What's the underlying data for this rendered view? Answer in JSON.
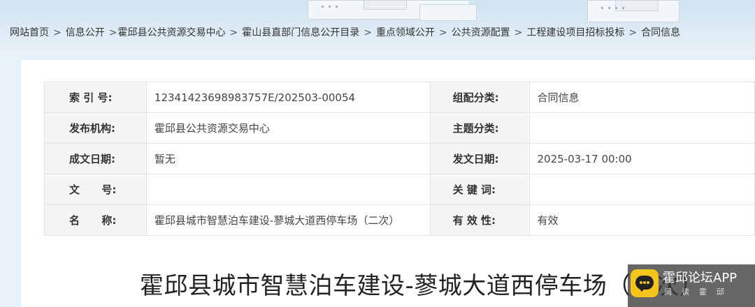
{
  "breadcrumb": [
    "网站首页",
    "信息公开",
    "霍邱县公共资源交易中心",
    "霍山县直部门信息公开目录",
    "重点领域公开",
    "公共资源配置",
    "工程建设项目招标投标",
    "合同信息"
  ],
  "meta": {
    "index_label": "索 引 号:",
    "index_value": "12341423698983757E/202503-00054",
    "category_label": "组配分类:",
    "category_value": "合同信息",
    "publisher_label": "发布机构:",
    "publisher_value": "霍邱县公共资源交易中心",
    "topic_label": "主题分类:",
    "topic_value": "",
    "created_label": "成文日期:",
    "created_value": "暂无",
    "issued_label": "发文日期:",
    "issued_value": "2025-03-17 00:00",
    "docno_label": "文      号:",
    "docno_value": "",
    "keywords_label": "关 键 词:",
    "keywords_value": "",
    "name_label": "名      称:",
    "name_value": "霍邱县城市智慧泊车建设-蓼城大道西停车场（二次）",
    "validity_label": "有 效 性:",
    "validity_value": "有效"
  },
  "article": {
    "title": "霍邱县城市智慧泊车建设-蓼城大道西停车场（二次）"
  },
  "watermark": {
    "name": "霍邱论坛APP",
    "tagline": "阅读霍邱",
    "logo_icon": "chat-bubble-icon"
  }
}
